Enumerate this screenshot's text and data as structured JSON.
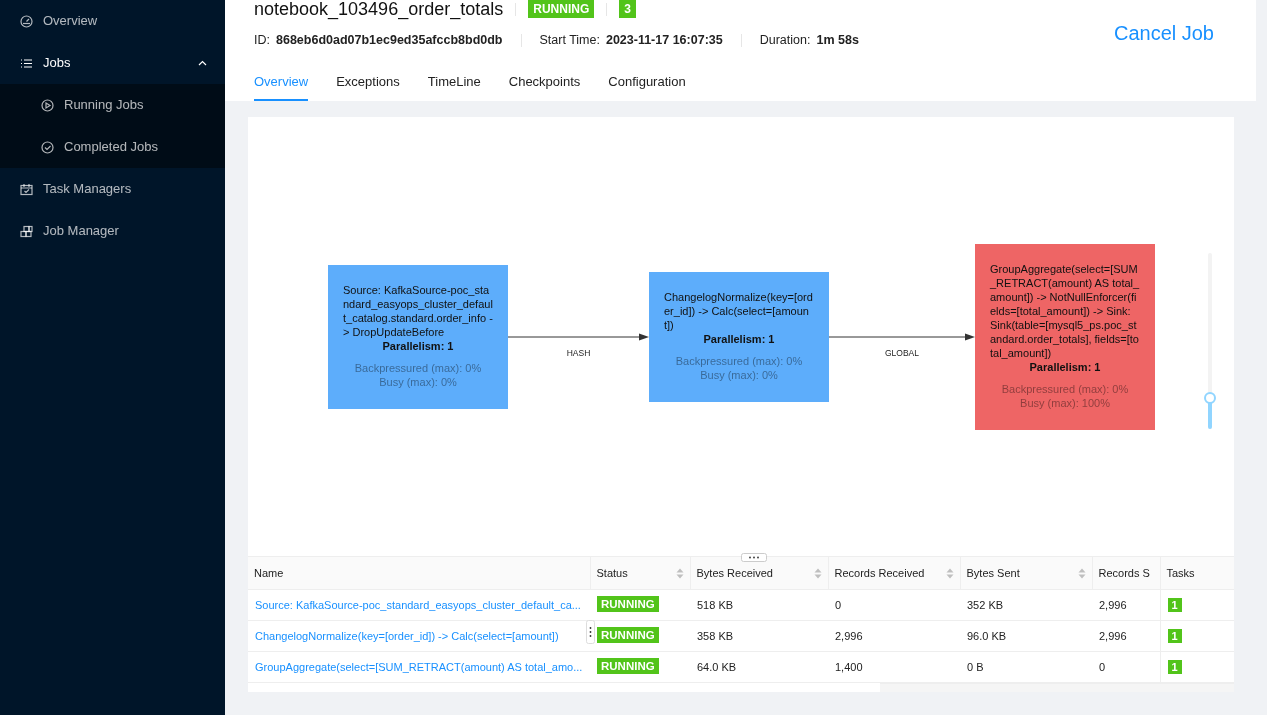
{
  "sidebar": {
    "items": [
      {
        "label": "Overview"
      },
      {
        "label": "Jobs",
        "expanded": true,
        "children": [
          {
            "label": "Running Jobs"
          },
          {
            "label": "Completed Jobs"
          }
        ]
      },
      {
        "label": "Task Managers"
      },
      {
        "label": "Job Manager"
      }
    ]
  },
  "job": {
    "title": "notebook_103496_order_totals",
    "status": "RUNNING",
    "task_count": "3",
    "meta": [
      {
        "label": "ID:",
        "value": "868eb6d0ad07b1ec9ed35afccb8bd0db"
      },
      {
        "label": "Start Time:",
        "value": "2023-11-17 16:07:35"
      },
      {
        "label": "Duration:",
        "value": "1m 58s"
      }
    ],
    "cancel_button": "Cancel Job"
  },
  "tabs": [
    {
      "label": "Overview",
      "selected": true
    },
    {
      "label": "Exceptions",
      "selected": false
    },
    {
      "label": "TimeLine",
      "selected": false
    },
    {
      "label": "Checkpoints",
      "selected": false
    },
    {
      "label": "Configuration",
      "selected": false
    }
  ],
  "graph": {
    "nodes": [
      {
        "text": "Source: KafkaSource-poc_standard_easyops_cluster_default_catalog.standard.order_info -> DropUpdateBefore",
        "parallelism": "Parallelism: 1",
        "backpressured": "Backpressured (max): 0%",
        "busy": "Busy (max): 0%",
        "color": "#5dadfb"
      },
      {
        "text": "ChangelogNormalize(key=[order_id]) -> Calc(select=[amount])",
        "parallelism": "Parallelism: 1",
        "backpressured": "Backpressured (max): 0%",
        "busy": "Busy (max): 0%",
        "color": "#5dadfb"
      },
      {
        "text": "GroupAggregate(select=[SUM_RETRACT(amount) AS total_amount]) -> NotNullEnforcer(fields=[total_amount]) -> Sink: Sink(table=[mysql5_ps.poc_standard.order_totals], fields=[total_amount])",
        "parallelism": "Parallelism: 1",
        "backpressured": "Backpressured (max): 0%",
        "busy": "Busy (max): 100%",
        "color": "#ee6565"
      }
    ],
    "edges": [
      {
        "label": "HASH"
      },
      {
        "label": "GLOBAL"
      }
    ],
    "zoom": {
      "level": 0.18
    }
  },
  "table": {
    "columns": [
      {
        "label": "Name",
        "sortable": false
      },
      {
        "label": "Status",
        "sortable": true
      },
      {
        "label": "Bytes Received",
        "sortable": true
      },
      {
        "label": "Records Received",
        "sortable": true
      },
      {
        "label": "Bytes Sent",
        "sortable": true
      },
      {
        "label": "Records S",
        "sortable": false
      },
      {
        "label": "Tasks",
        "sortable": false
      }
    ],
    "rows": [
      {
        "name": "Source: KafkaSource-poc_standard_easyops_cluster_default_ca...",
        "status": "RUNNING",
        "bytes_received": "518 KB",
        "records_received": "0",
        "bytes_sent": "352 KB",
        "records_sent": "2,996",
        "tasks": "1"
      },
      {
        "name": "ChangelogNormalize(key=[order_id]) -> Calc(select=[amount])",
        "status": "RUNNING",
        "bytes_received": "358 KB",
        "records_received": "2,996",
        "bytes_sent": "96.0 KB",
        "records_sent": "2,996",
        "tasks": "1"
      },
      {
        "name": "GroupAggregate(select=[SUM_RETRACT(amount) AS total_amo...",
        "status": "RUNNING",
        "bytes_received": "64.0 KB",
        "records_received": "1,400",
        "bytes_sent": "0 B",
        "records_sent": "0",
        "tasks": "1"
      }
    ]
  }
}
